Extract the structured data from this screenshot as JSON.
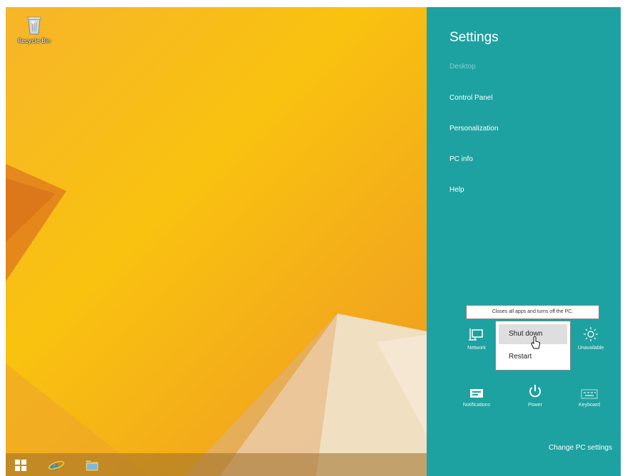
{
  "desktop": {
    "recycle_bin": {
      "label": "Recycle Bin",
      "icon": "recycle-bin-icon"
    },
    "taskbar": {
      "buttons": [
        {
          "icon": "windows-start-icon"
        },
        {
          "icon": "internet-explorer-icon"
        },
        {
          "icon": "file-explorer-icon"
        }
      ]
    }
  },
  "settings_charm": {
    "title": "Settings",
    "subtitle": "Desktop",
    "links": [
      "Control Panel",
      "Personalization",
      "PC info",
      "Help"
    ],
    "tiles": [
      {
        "label": "Network",
        "icon": "network-icon"
      },
      {
        "label": "Unavailable",
        "icon": "brightness-icon"
      },
      {
        "label": "Notifications",
        "icon": "notifications-icon"
      },
      {
        "label": "Power",
        "icon": "power-icon"
      },
      {
        "label": "Keyboard",
        "icon": "keyboard-icon"
      }
    ],
    "change_pc_settings": "Change PC settings"
  },
  "power_menu": {
    "tooltip": "Closes all apps and turns off the PC.",
    "items": [
      "Shut down",
      "Restart"
    ],
    "hovered_item": "Shut down"
  },
  "colors": {
    "charm_background": "#1ea1a1",
    "desktop_accent": "#f9c20f"
  }
}
